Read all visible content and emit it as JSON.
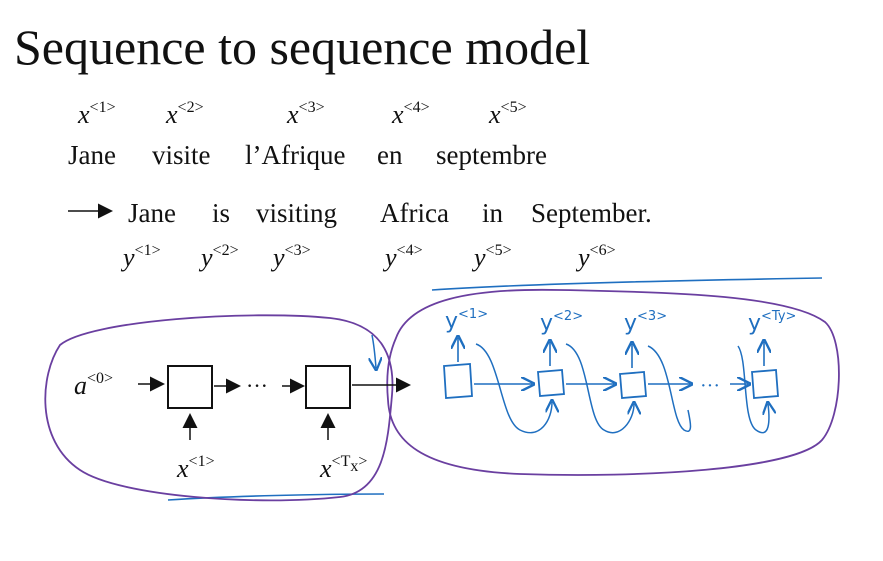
{
  "title": "Sequence to sequence model",
  "input_tokens": [
    {
      "base": "x",
      "sup": "<1>"
    },
    {
      "base": "x",
      "sup": "<2>"
    },
    {
      "base": "x",
      "sup": "<3>"
    },
    {
      "base": "x",
      "sup": "<4>"
    },
    {
      "base": "x",
      "sup": "<5>"
    }
  ],
  "source_sentence": [
    "Jane",
    "visite",
    "l’Afrique",
    "en",
    "septembre"
  ],
  "target_sentence": [
    "Jane",
    "is",
    "visiting",
    "Africa",
    "in",
    "September."
  ],
  "output_tokens": [
    {
      "base": "y",
      "sup": "<1>"
    },
    {
      "base": "y",
      "sup": "<2>"
    },
    {
      "base": "y",
      "sup": "<3>"
    },
    {
      "base": "y",
      "sup": "<4>"
    },
    {
      "base": "y",
      "sup": "<5>"
    },
    {
      "base": "y",
      "sup": "<6>"
    }
  ],
  "encoder": {
    "initial_state": {
      "base": "a",
      "sup": "<0>"
    },
    "dots": "···",
    "inputs": [
      {
        "base": "x",
        "sup": "<1>"
      },
      {
        "base": "x",
        "sup": "<T",
        "sub": "x",
        "sup_end": ">"
      }
    ]
  },
  "decoder": {
    "outputs": [
      {
        "base": "y",
        "sup": "<1>"
      },
      {
        "base": "y",
        "sup": "<2>"
      },
      {
        "base": "y",
        "sup": "<3>"
      },
      {
        "base": "y",
        "sup": "<Ty>"
      }
    ],
    "dots": "···"
  },
  "colors": {
    "ink": "#111111",
    "encoder_outline": "#6a3fa0",
    "handwriting": "#1f6fc0"
  }
}
